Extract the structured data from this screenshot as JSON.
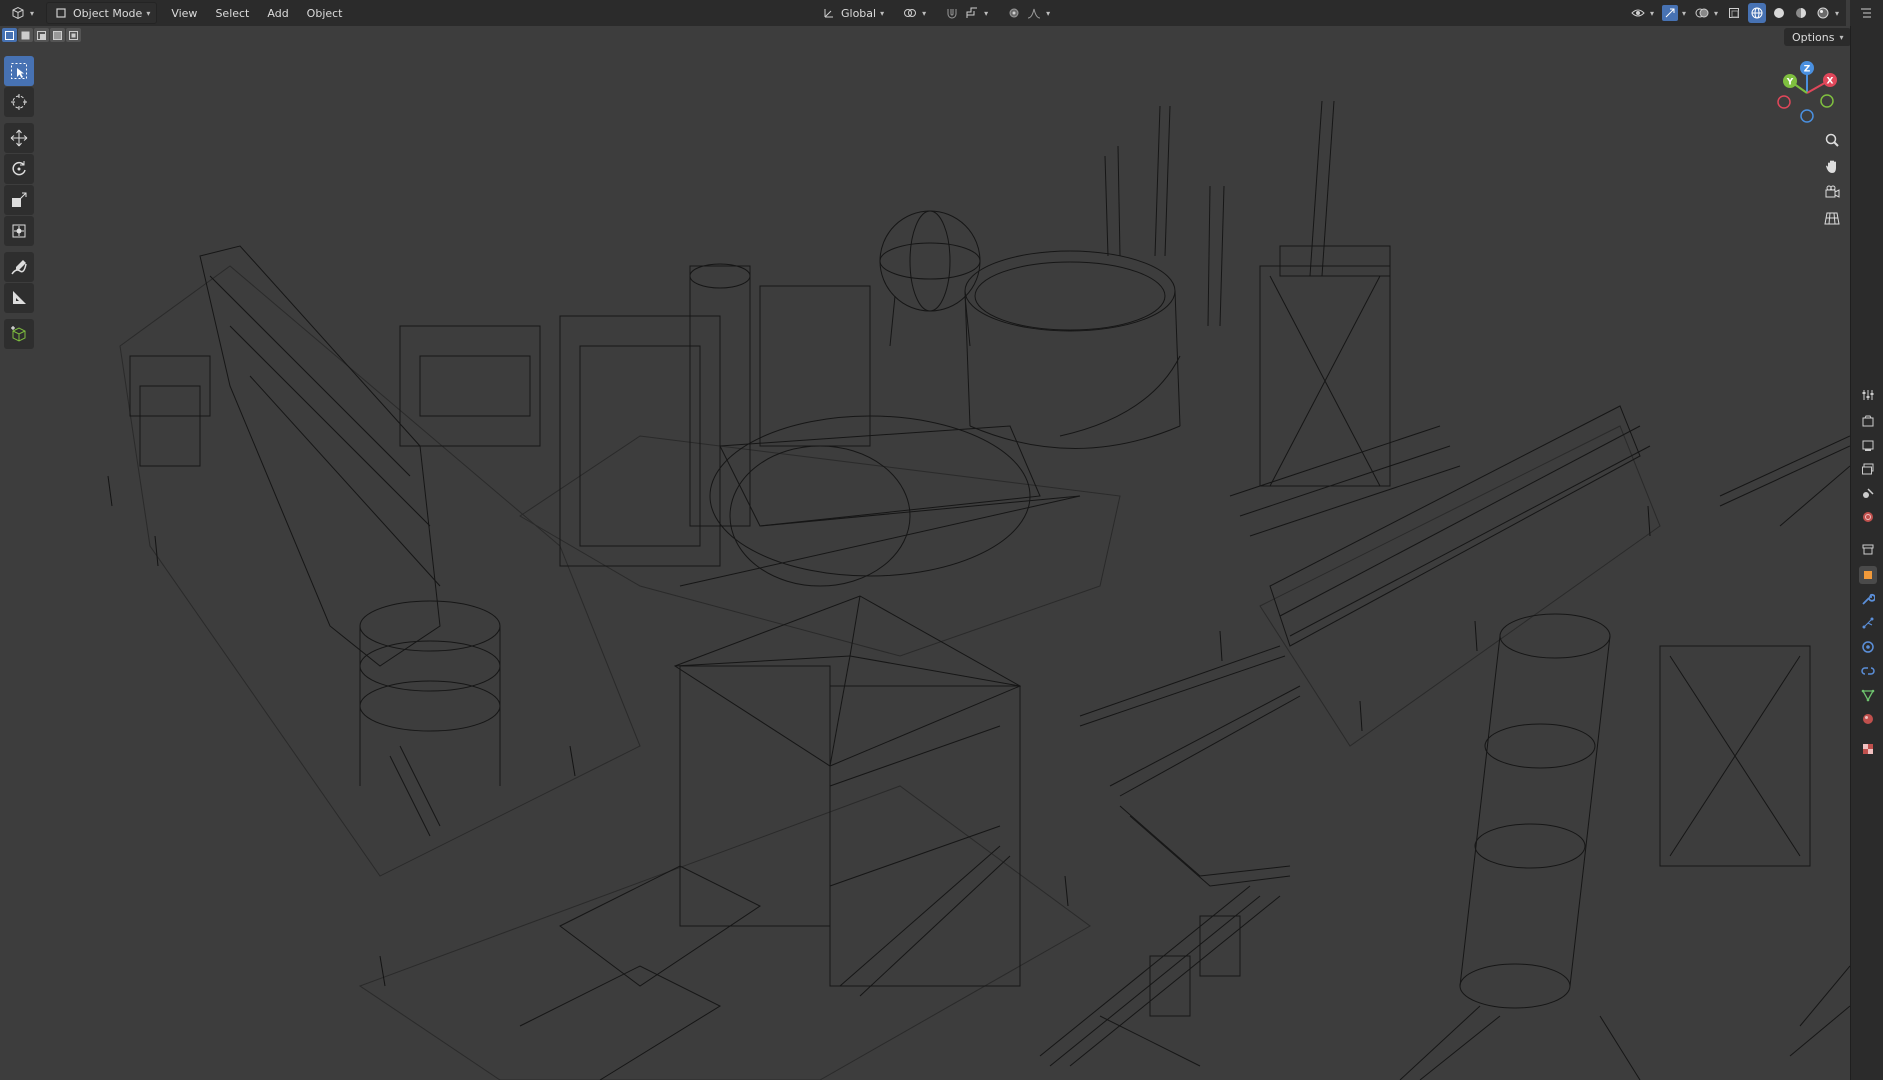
{
  "header": {
    "editor_type_icon": "3d-viewport-icon",
    "mode_label": "Object Mode",
    "menu": [
      "View",
      "Select",
      "Add",
      "Object"
    ],
    "transform_orientation": "Global"
  },
  "options": {
    "label": "Options"
  },
  "select_modes": [
    "select-new-icon",
    "select-extend-icon",
    "select-subtract-icon",
    "select-invert-icon",
    "select-intersect-icon"
  ],
  "toolbar": {
    "tools": [
      {
        "name": "select-box-tool",
        "active": true
      },
      {
        "name": "cursor-tool"
      },
      {
        "name": "move-tool"
      },
      {
        "name": "rotate-tool"
      },
      {
        "name": "scale-tool"
      },
      {
        "name": "transform-tool"
      },
      {
        "name": "annotate-tool"
      },
      {
        "name": "measure-tool"
      },
      {
        "name": "add-cube-tool"
      }
    ]
  },
  "gizmo": {
    "axes": [
      "X",
      "Y",
      "Z"
    ]
  },
  "colors": {
    "accent": "#4772b3",
    "viewport_bg": "#3d3d3d",
    "header_bg": "#2b2b2b",
    "axis_x": "#e0475a",
    "axis_y": "#7fbf3f",
    "axis_z": "#4a90e0",
    "wire": "#1a1a1a"
  },
  "properties_tabs": [
    "tool",
    "render",
    "output",
    "view-layer",
    "scene",
    "world",
    "collection",
    "object",
    "modifiers",
    "particles",
    "physics",
    "constraints",
    "data",
    "material",
    "texture"
  ]
}
